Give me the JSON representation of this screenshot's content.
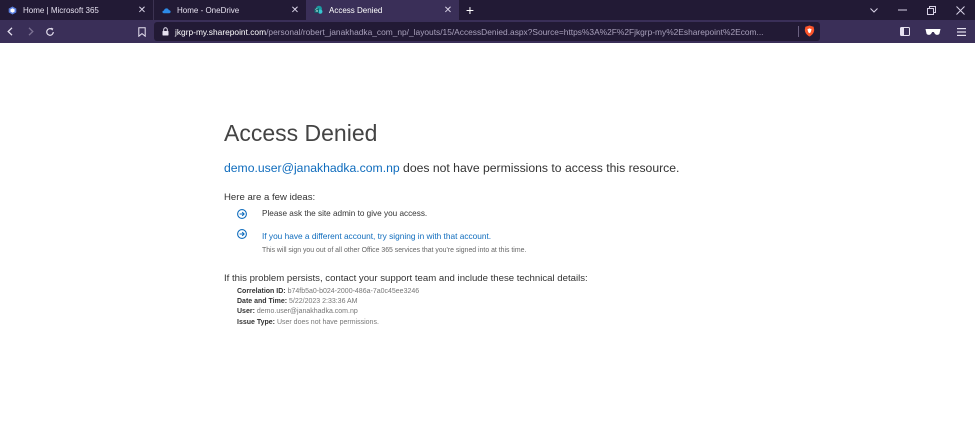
{
  "browser": {
    "tabs": [
      {
        "title": "Home | Microsoft 365",
        "icon": "microsoft-365-icon",
        "active": false
      },
      {
        "title": "Home - OneDrive",
        "icon": "onedrive-icon",
        "active": false
      },
      {
        "title": "Access Denied",
        "icon": "sharepoint-icon",
        "active": true
      }
    ],
    "new_tab_label": "+",
    "url_host": "jkgrp-my.sharepoint.com",
    "url_path": "/personal/robert_janakhadka_com_np/_layouts/15/AccessDenied.aspx?Source=https%3A%2F%2Fjkgrp-my%2Esharepoint%2Ecom...",
    "colors": {
      "tabbar": "#221a35",
      "toolbar": "#3a2f58",
      "url_field": "#221a35"
    }
  },
  "page": {
    "title": "Access Denied",
    "message_user": "demo.user@janakhadka.com.np",
    "message_rest": " does not have permissions to access this resource.",
    "ideas_heading": "Here are a few ideas:",
    "idea_1": "Please ask the site admin to give you access.",
    "idea_2_link": "If you have a different account, try signing in with that account.",
    "idea_2_note": "This will sign you out of all other Office 365 services that you're signed into at this time.",
    "persist_text": "If this problem persists, contact your support team and include these technical details:",
    "details": [
      {
        "key": "Correlation ID:",
        "value": "b74fb5a0-b024-2000-486a-7a0c45ee3246"
      },
      {
        "key": "Date and Time:",
        "value": "5/22/2023 2:33:36 AM"
      },
      {
        "key": "User:",
        "value": "demo.user@janakhadka.com.np"
      },
      {
        "key": "Issue Type:",
        "value": "User does not have permissions."
      }
    ],
    "colors": {
      "link": "#0f6cbd",
      "text": "#333333",
      "muted": "#777777"
    }
  }
}
